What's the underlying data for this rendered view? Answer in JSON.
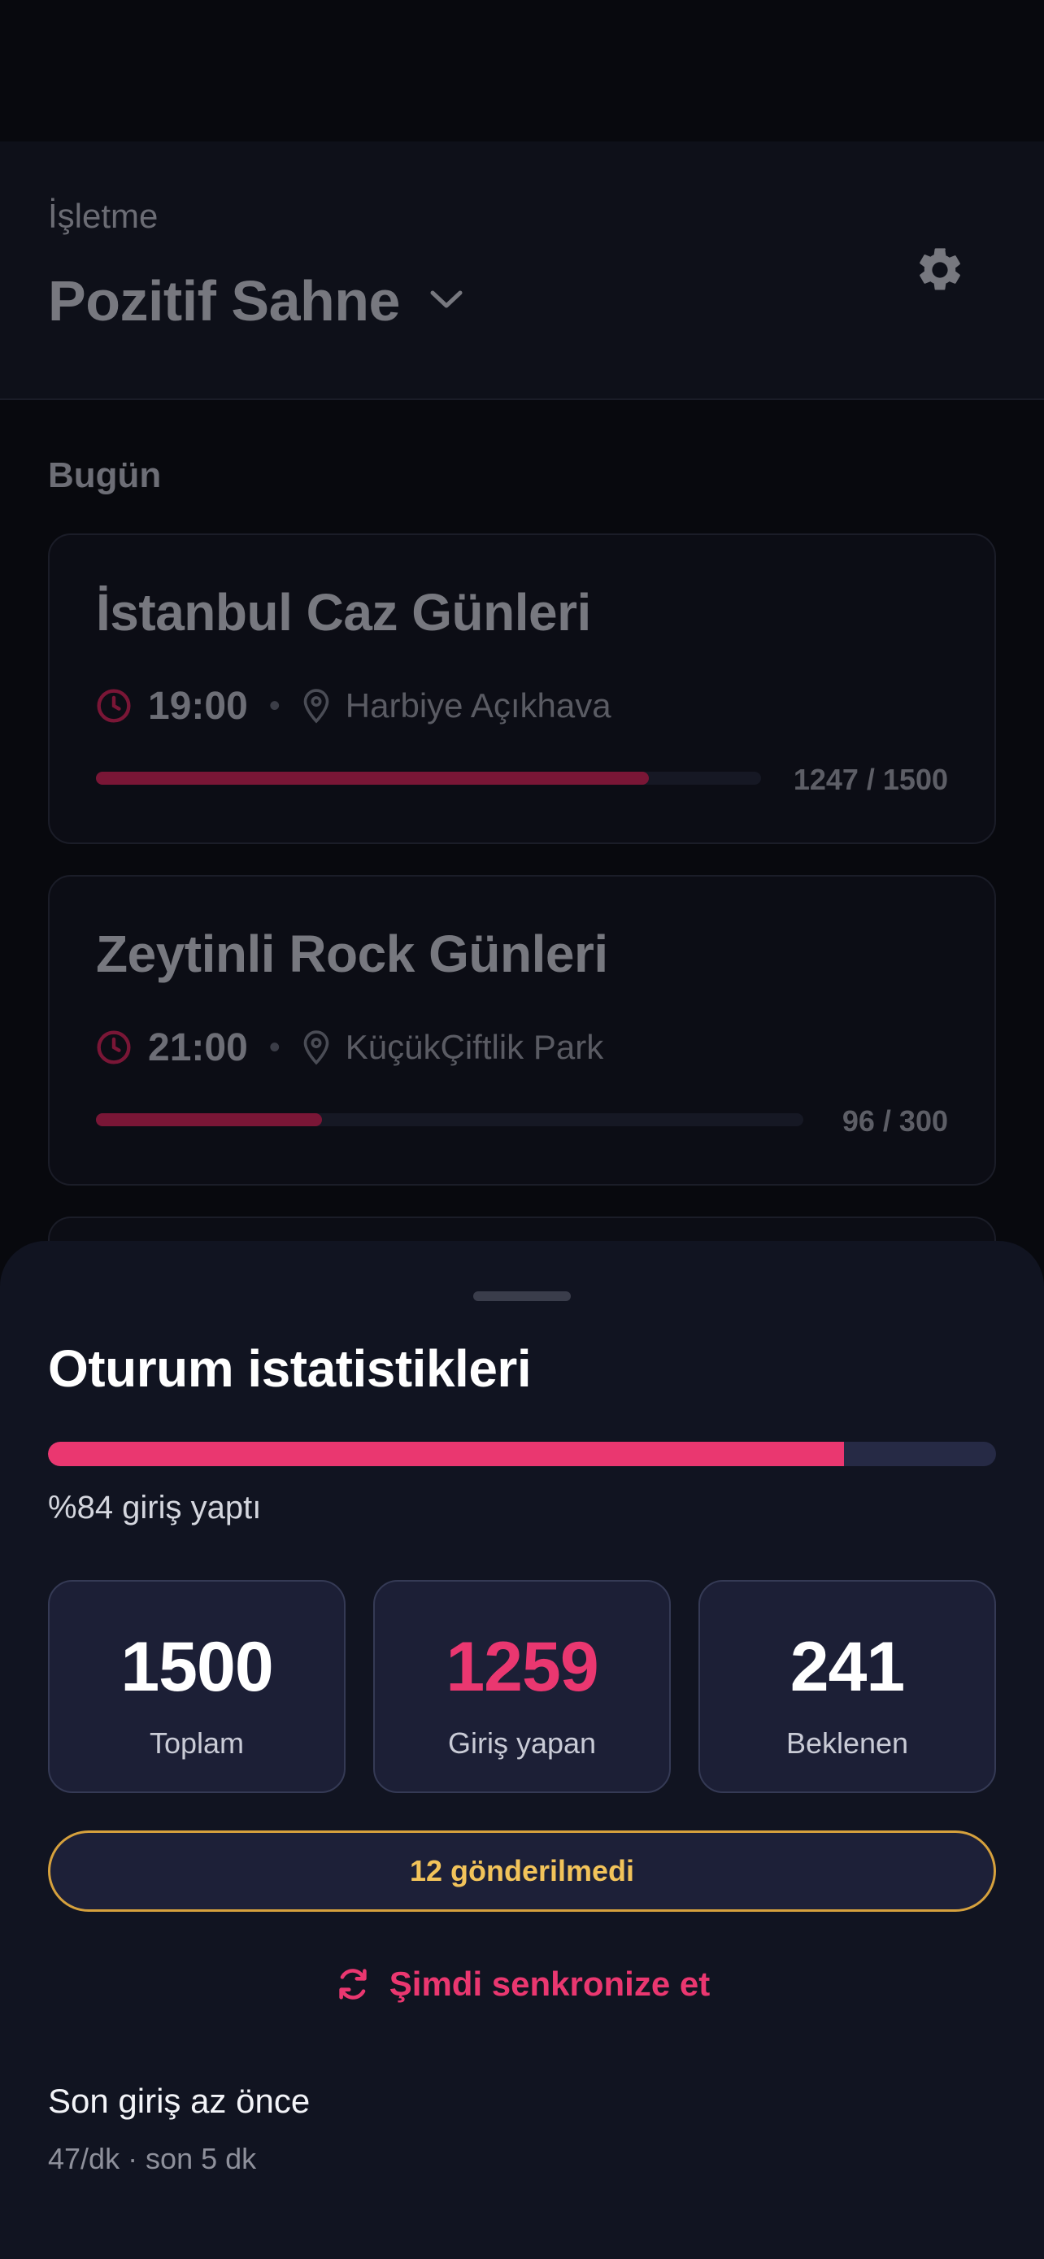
{
  "header": {
    "business_label": "İşletme",
    "business_name": "Pozitif Sahne"
  },
  "today_label": "Bugün",
  "events": [
    {
      "title": "İstanbul Caz Günleri",
      "time": "19:00",
      "venue": "Harbiye Açıkhava",
      "count": "1247 / 1500",
      "progress": 0.831
    },
    {
      "title": "Zeytinli Rock Günleri",
      "time": "21:00",
      "venue": "KüçükÇiftlik Park",
      "count": "96 / 300",
      "progress": 0.32
    }
  ],
  "sheet": {
    "title": "Oturum istatistikleri",
    "checked_in_percent": 84,
    "percent_text": "%84 giriş yaptı",
    "stats": [
      {
        "value": "1500",
        "label": "Toplam"
      },
      {
        "value": "1259",
        "label": "Giriş yapan"
      },
      {
        "value": "241",
        "label": "Beklenen"
      }
    ],
    "unsent_label": "12 gönderilmedi",
    "sync_label": "Şimdi senkronize et",
    "last_checkin": "Son giriş az önce",
    "rate": "47/dk · son 5 dk"
  },
  "colors": {
    "accent": "#ea3770",
    "warning": "#f2c35a",
    "progress_dim": "#7a1636"
  },
  "icons": [
    "chevron-down-icon",
    "gear-icon",
    "clock-icon",
    "location-pin-icon",
    "sync-icon"
  ]
}
